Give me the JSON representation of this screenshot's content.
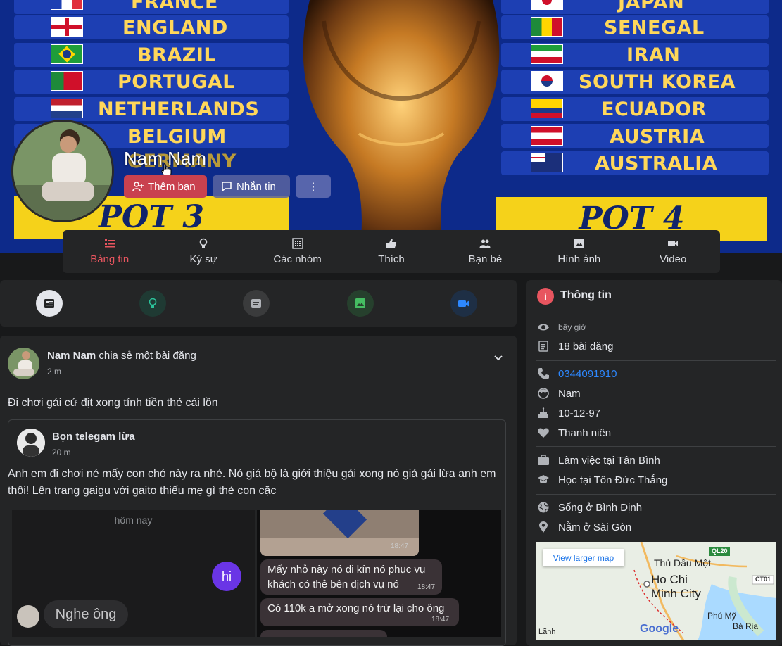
{
  "cover": {
    "left_countries": [
      "FRANCE",
      "ENGLAND",
      "BRAZIL",
      "PORTUGAL",
      "NETHERLANDS",
      "BELGIUM",
      "GERMANY"
    ],
    "right_countries": [
      "JAPAN",
      "SENEGAL",
      "IRAN",
      "SOUTH KOREA",
      "ECUADOR",
      "AUSTRIA",
      "AUSTRALIA"
    ],
    "pot_left": "POT 3",
    "pot_right": "POT 4"
  },
  "profile": {
    "name": "Nam Nam",
    "add_friend": "Thêm bạn",
    "message": "Nhắn tin",
    "more": "⋮"
  },
  "nav": {
    "items": [
      {
        "label": "Bảng tin",
        "icon": "feed-icon"
      },
      {
        "label": "Ký sự",
        "icon": "bulb-icon"
      },
      {
        "label": "Các nhóm",
        "icon": "groups-icon"
      },
      {
        "label": "Thích",
        "icon": "like-icon"
      },
      {
        "label": "Bạn bè",
        "icon": "friends-icon"
      },
      {
        "label": "Hình ảnh",
        "icon": "image-icon"
      },
      {
        "label": "Video",
        "icon": "video-icon"
      }
    ]
  },
  "post": {
    "author": "Nam Nam",
    "action": "chia sẻ một bài đăng",
    "time": "2 m",
    "text": "Đi chơi gái cứ địt xong tính tiền thẻ cái lồn",
    "shared": {
      "author": "Bọn telegam lừa",
      "time": "20 m",
      "text": "Anh em đi chơi né mấy con chó này ra nhé. Nó giá bộ là giới thiệu gái xong nó giá gái lừa anh em thôi! Lên trang gaigu với gaito thiếu mẹ gì thẻ con cặc",
      "left_shot": {
        "day": "hôm nay",
        "hi": "hi",
        "reply": "Nghe ông"
      },
      "right_shot": {
        "t1": "18:47",
        "m1": "Mấy nhỏ này nó đi kín nó phục vụ khách có thẻ bên dịch vụ nó",
        "t2": "18:47",
        "m2": "Có 110k a mở xong nó trừ lại cho ông",
        "t3": "18:47"
      }
    }
  },
  "info": {
    "title": "Thông tin",
    "seen": "bây giờ",
    "posts": "18 bài đăng",
    "phone": "0344091910",
    "gender": "Nam",
    "birthday": "10-12-97",
    "relation": "Thanh niên",
    "work": "Làm việc tại Tân Bình",
    "study": "Học tại Tôn Đức Thắng",
    "lives": "Sống ở Bình Định",
    "location": "Nằm ở Sài Gòn",
    "map": {
      "button": "View larger map",
      "city1": "Thủ Dầu Một",
      "city2": "Ho Chi Minh City",
      "city3": "Phú Mỹ",
      "city4": "Bà Rịa",
      "road1": "QL20",
      "road2": "CT01",
      "brand": "Google",
      "city5": "Lãnh"
    }
  },
  "colors": {
    "accent": "#e8555f",
    "link": "#2d88ff",
    "card": "#242526",
    "bg": "#18191a"
  }
}
